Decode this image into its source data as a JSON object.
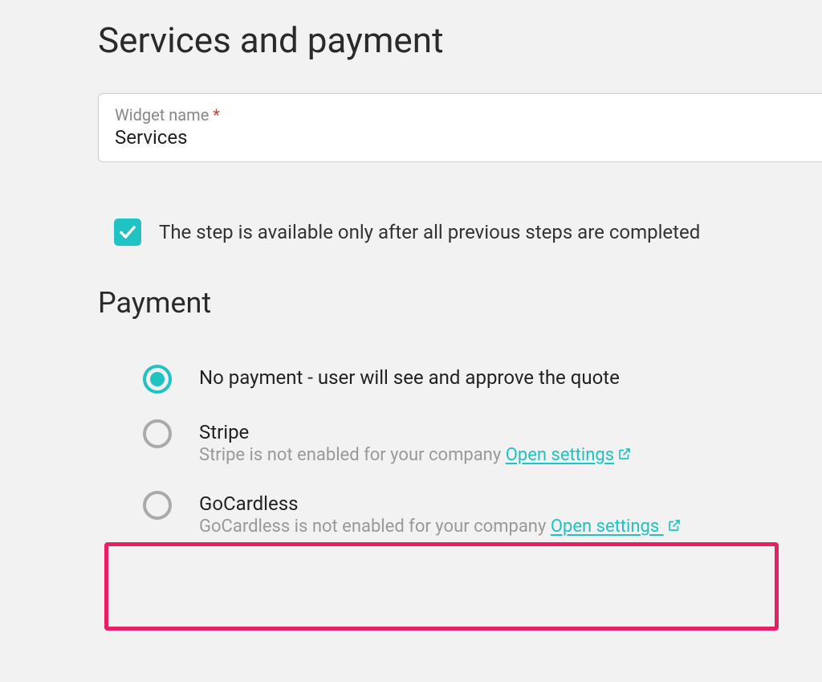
{
  "page": {
    "title": "Services and payment"
  },
  "widgetName": {
    "label": "Widget name",
    "required": "*",
    "value": "Services"
  },
  "checkbox": {
    "label": "The step is available only after all previous steps are completed"
  },
  "paymentSection": {
    "title": "Payment"
  },
  "paymentOptions": {
    "noPayment": {
      "label": "No payment - user will see and approve the quote"
    },
    "stripe": {
      "label": "Stripe",
      "sub": "Stripe is not enabled for your company ",
      "link": "Open settings"
    },
    "gocardless": {
      "label": "GoCardless",
      "sub": "GoCardless is not enabled for your company ",
      "link": "Open settings "
    }
  }
}
